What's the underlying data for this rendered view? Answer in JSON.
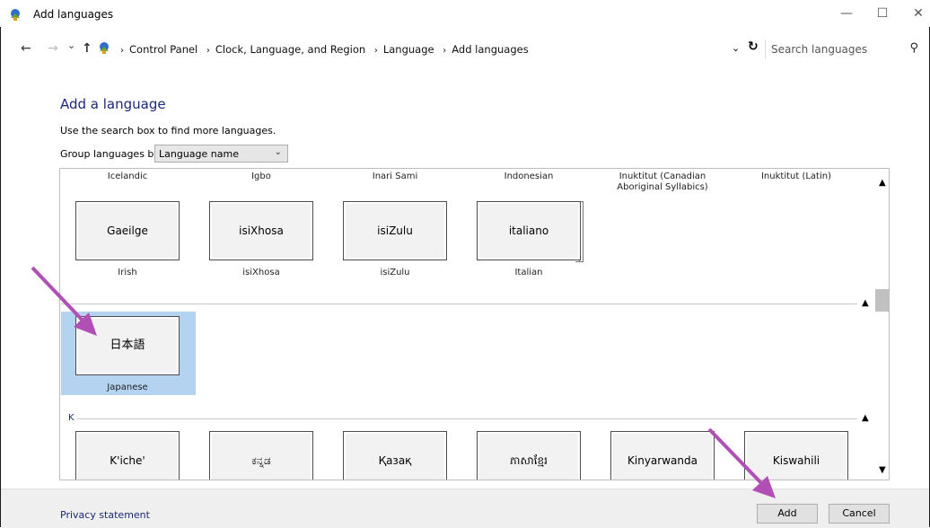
{
  "window": {
    "title": "Add languages",
    "minimize": "—",
    "maximize": "☐",
    "close": "✕"
  },
  "address": {
    "back": "←",
    "forward": "→",
    "recent": "⌄",
    "up": "↑",
    "breadcrumbs": [
      "Control Panel",
      "Clock, Language, and Region",
      "Language",
      "Add languages"
    ],
    "separator": "›",
    "dropdown": "⌄",
    "refresh": "↻",
    "search_placeholder": "Search languages",
    "search_icon": "⚲"
  },
  "page": {
    "title": "Add a language",
    "hint": "Use the search box to find more languages.",
    "group_label": "Group languages by:",
    "group_value": "Language name"
  },
  "list": {
    "top_row": [
      "Icelandic",
      "Igbo",
      "Inari Sami",
      "Indonesian",
      "Inuktitut (Canadian Aboriginal Syllabics)",
      "Inuktitut (Latin)"
    ],
    "i_row": [
      {
        "native": "Gaeilge",
        "english": "Irish"
      },
      {
        "native": "isiXhosa",
        "english": "isiXhosa"
      },
      {
        "native": "isiZulu",
        "english": "isiZulu"
      },
      {
        "native": "italiano",
        "english": "Italian"
      }
    ],
    "j_row": [
      {
        "native": "日本語",
        "english": "Japanese"
      }
    ],
    "k_group_label": "K",
    "k_row": [
      {
        "native": "K'iche'"
      },
      {
        "native": "ಕನ್ನಡ"
      },
      {
        "native": "Қазақ"
      },
      {
        "native": "ភាសាខ្មែរ"
      },
      {
        "native": "Kinyarwanda"
      },
      {
        "native": "Kiswahili"
      }
    ],
    "collapse_icon": "▲",
    "scroll_up": "▲",
    "scroll_down": "▼"
  },
  "footer": {
    "privacy": "Privacy statement",
    "add": "Add",
    "cancel": "Cancel"
  },
  "colors": {
    "link": "#1b2a78",
    "selection": "#b4d3f0",
    "annotation_arrow": "#b14fb6"
  }
}
